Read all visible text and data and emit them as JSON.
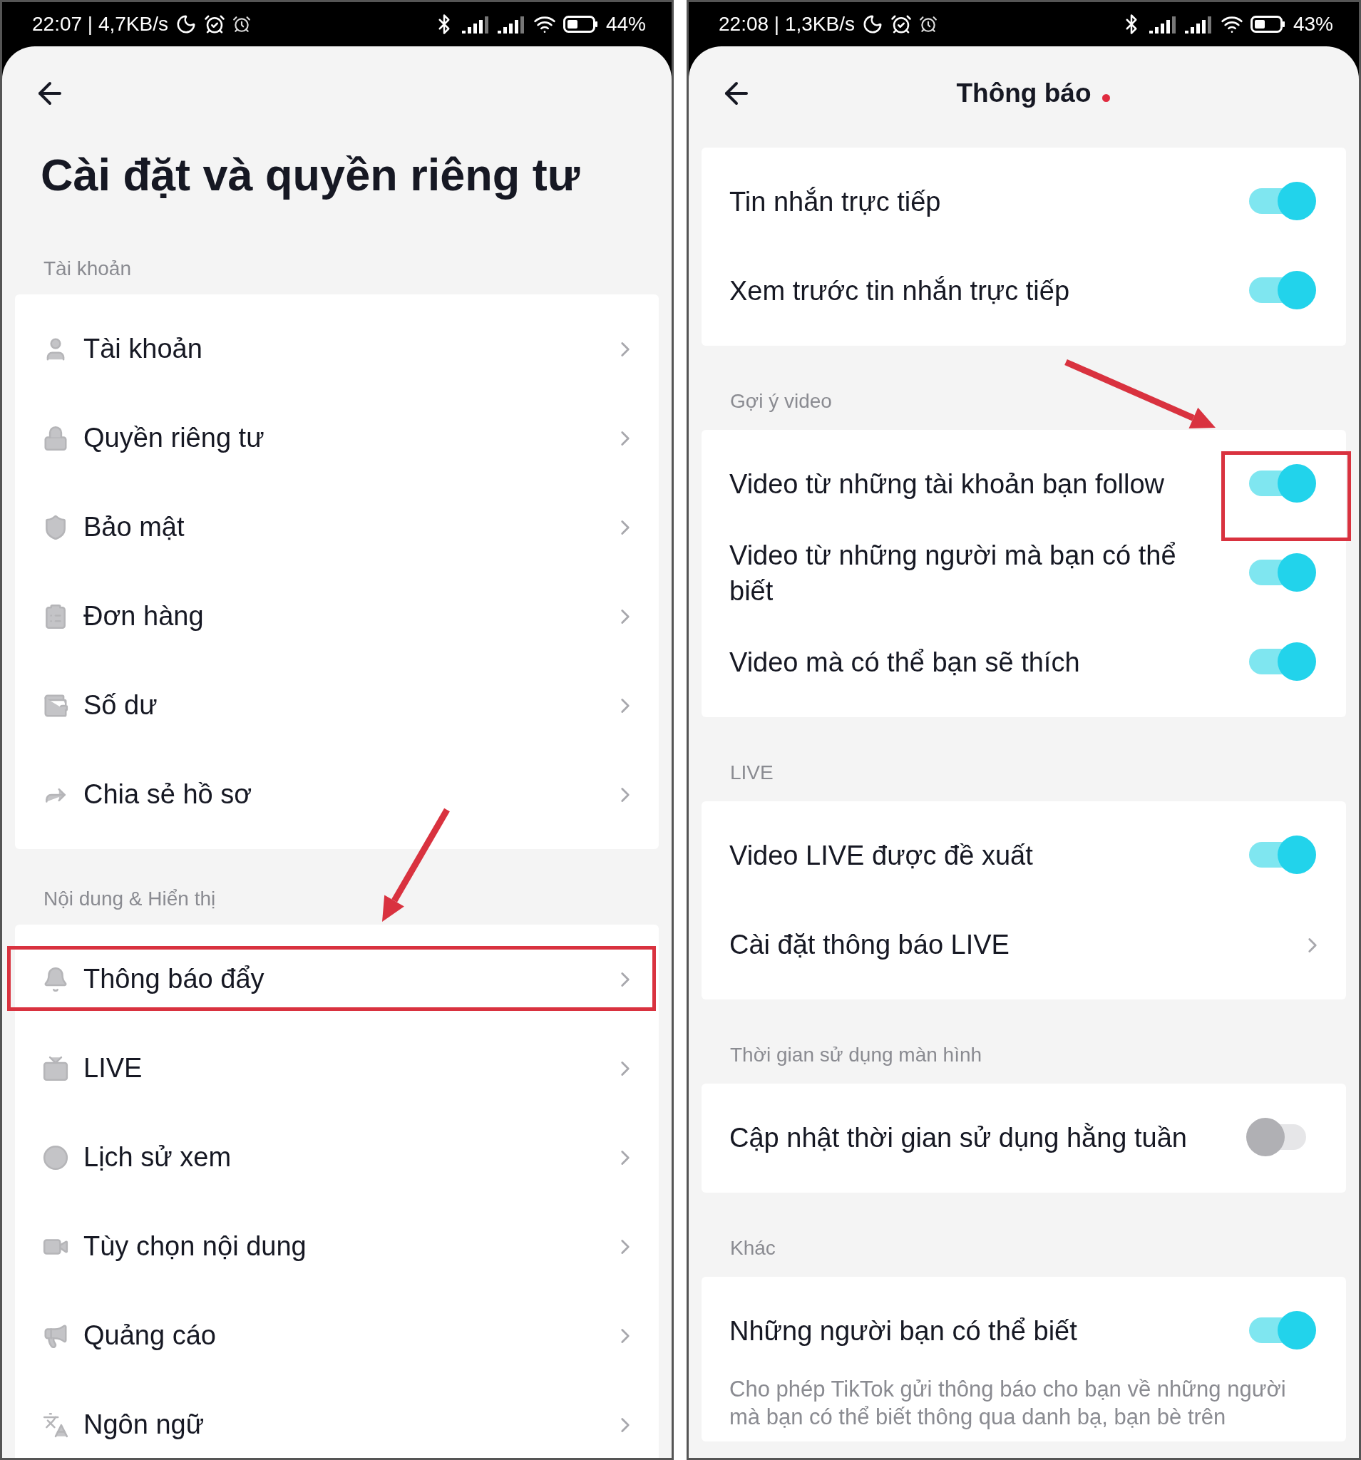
{
  "left_screen": {
    "status_bar": {
      "time_speed": "22:07 | 4,7KB/s",
      "battery": "44%"
    },
    "title": "Cài đặt và quyền riêng tư",
    "sections": [
      {
        "label": "Tài khoản",
        "items": [
          {
            "label": "Tài khoản",
            "highlighted": false
          },
          {
            "label": "Quyền riêng tư",
            "highlighted": false
          },
          {
            "label": "Bảo mật",
            "highlighted": false
          },
          {
            "label": "Đơn hàng",
            "highlighted": false
          },
          {
            "label": "Số dư",
            "highlighted": false
          },
          {
            "label": "Chia sẻ hồ sơ",
            "highlighted": false
          }
        ]
      },
      {
        "label": "Nội dung & Hiển thị",
        "items": [
          {
            "label": "Thông báo đẩy",
            "highlighted": true
          },
          {
            "label": "LIVE",
            "highlighted": false
          },
          {
            "label": "Lịch sử xem",
            "highlighted": false
          },
          {
            "label": "Tùy chọn nội dung",
            "highlighted": false
          },
          {
            "label": "Quảng cáo",
            "highlighted": false
          },
          {
            "label": "Ngôn ngữ",
            "highlighted": false
          }
        ]
      }
    ]
  },
  "right_screen": {
    "status_bar": {
      "time_speed": "22:08 | 1,3KB/s",
      "battery": "43%"
    },
    "title": "Thông báo",
    "unread_dot": true,
    "sections": [
      {
        "items": [
          {
            "kind": "toggle",
            "label": "Tin nhắn trực tiếp",
            "on": true,
            "highlighted": false
          },
          {
            "kind": "toggle",
            "label": "Xem trước tin nhắn trực tiếp",
            "on": true,
            "highlighted": false
          }
        ]
      },
      {
        "label": "Gợi ý video",
        "items": [
          {
            "kind": "toggle",
            "label": "Video từ những tài khoản bạn follow",
            "on": true,
            "highlighted": true
          },
          {
            "kind": "toggle",
            "label": "Video từ những người mà bạn có thể biết",
            "on": true,
            "highlighted": false
          },
          {
            "kind": "toggle",
            "label": "Video mà có thể bạn sẽ thích",
            "on": true,
            "highlighted": false
          }
        ]
      },
      {
        "label": "LIVE",
        "items": [
          {
            "kind": "toggle",
            "label": "Video LIVE được đề xuất",
            "on": true,
            "highlighted": false
          },
          {
            "kind": "link",
            "label": "Cài đặt thông báo LIVE"
          }
        ]
      },
      {
        "label": "Thời gian sử dụng màn hình",
        "items": [
          {
            "kind": "toggle",
            "label": "Cập nhật thời gian sử dụng hằng tuần",
            "on": false,
            "highlighted": false
          }
        ]
      },
      {
        "label": "Khác",
        "items": [
          {
            "kind": "toggle",
            "label": "Những người bạn có thể biết",
            "on": true,
            "highlighted": false,
            "description": "Cho phép TikTok gửi thông báo cho bạn về những người mà bạn có thể biết thông qua danh bạ, bạn bè trên"
          }
        ]
      }
    ]
  }
}
